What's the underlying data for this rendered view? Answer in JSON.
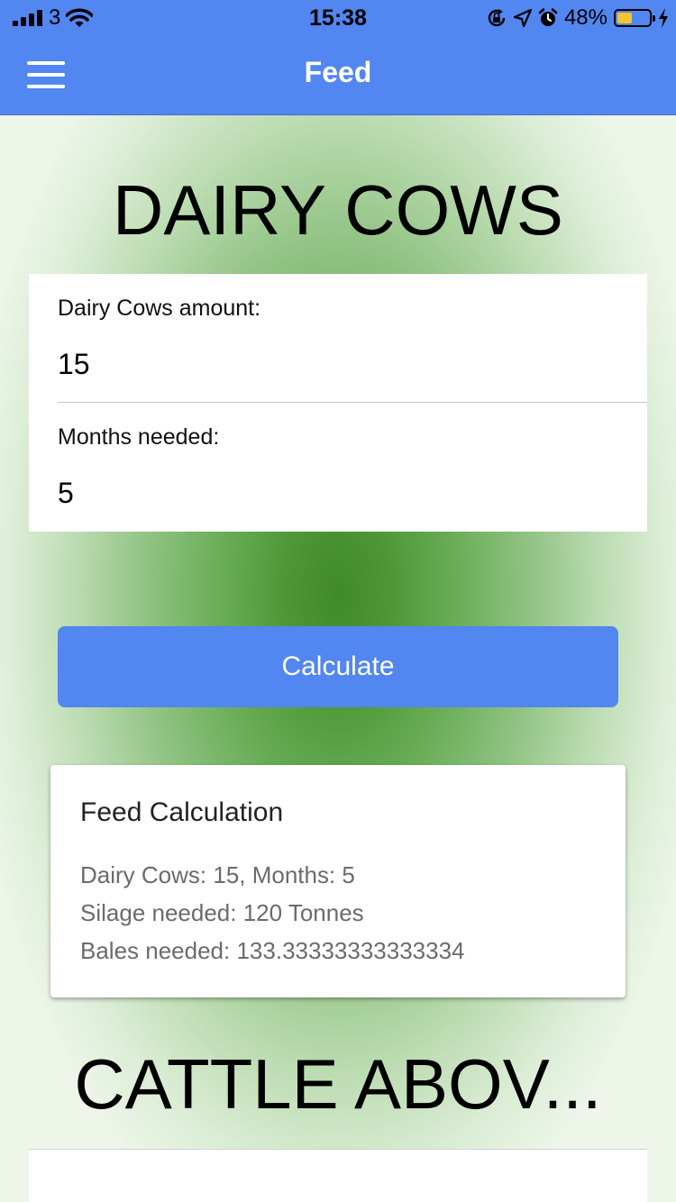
{
  "status_bar": {
    "carrier": "3",
    "time": "15:38",
    "battery_percent": "48%",
    "battery_level": 0.48,
    "icons": [
      "signal-icon",
      "wifi-icon",
      "rotation-lock-icon",
      "location-icon",
      "alarm-icon",
      "battery-icon",
      "charging-icon"
    ]
  },
  "nav": {
    "title": "Feed",
    "menu_icon": "hamburger-menu-icon"
  },
  "dairy_section": {
    "title": "DAIRY COWS",
    "fields": [
      {
        "label": "Dairy Cows amount:",
        "value": "15"
      },
      {
        "label": "Months needed:",
        "value": "5"
      }
    ],
    "calculate_label": "Calculate"
  },
  "result": {
    "title": "Feed Calculation",
    "lines": [
      "Dairy Cows: 15, Months: 5",
      "Silage needed: 120 Tonnes",
      "Bales needed: 133.33333333333334"
    ]
  },
  "cattle_section": {
    "title": "CATTLE ABOV..."
  },
  "colors": {
    "header_blue": "#5286f0",
    "button_blue": "#5286f0",
    "background_green": "#3f8a2b",
    "battery_yellow": "#f4c430"
  }
}
